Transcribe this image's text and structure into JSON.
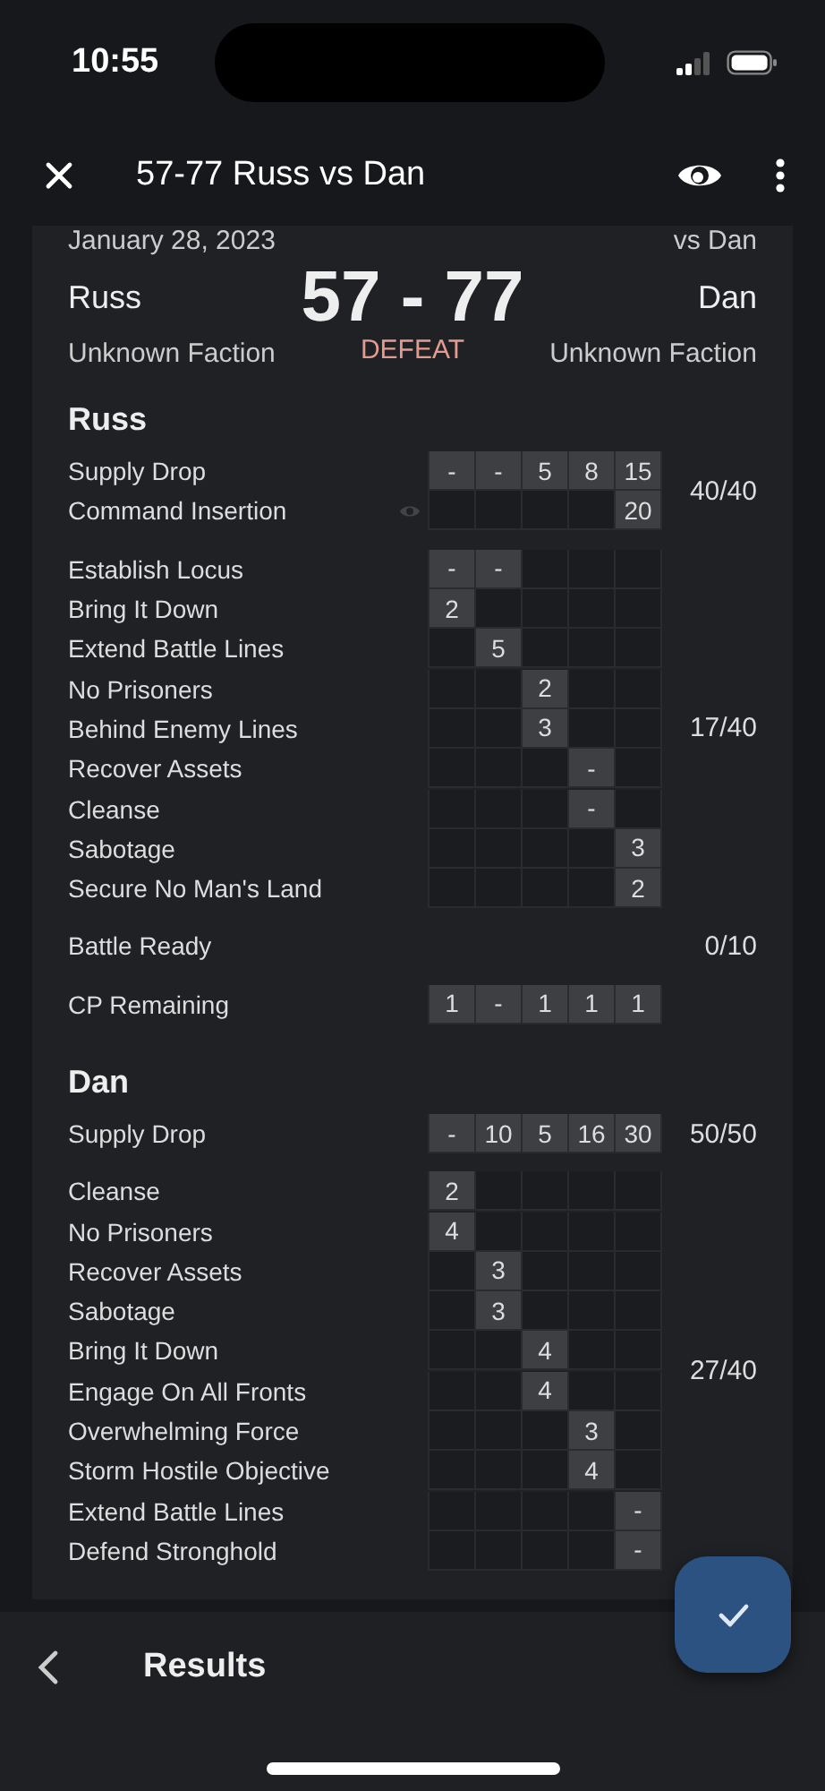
{
  "status_bar": {
    "time": "10:55"
  },
  "header": {
    "title": "57-77 Russ vs Dan"
  },
  "summary": {
    "date": "January 28, 2023",
    "opponent": "vs Dan",
    "left": {
      "name": "Russ",
      "faction": "Unknown Faction"
    },
    "right": {
      "name": "Dan",
      "faction": "Unknown Faction"
    },
    "score": "57 - 77",
    "result": "DEFEAT"
  },
  "players": [
    {
      "name": "Russ",
      "groups": [
        {
          "kind": "grid",
          "total": "40/40",
          "rows": [
            {
              "label": "Supply Drop",
              "secret": false,
              "cells": [
                "-",
                "-",
                "5",
                "8",
                "15"
              ]
            },
            {
              "label": "Command Insertion",
              "secret": true,
              "cells": [
                null,
                null,
                null,
                null,
                "20"
              ]
            }
          ]
        },
        {
          "kind": "grid",
          "total": "17/40",
          "rows": [
            {
              "label": "Establish Locus",
              "secret": false,
              "cells": [
                "-",
                "-",
                null,
                null,
                null
              ]
            },
            {
              "label": "Bring It Down",
              "secret": false,
              "cells": [
                "2",
                null,
                null,
                null,
                null
              ]
            },
            {
              "label": "Extend Battle Lines",
              "secret": false,
              "cells": [
                null,
                "5",
                null,
                null,
                null
              ]
            },
            {
              "label": "No Prisoners",
              "secret": false,
              "cells": [
                null,
                null,
                "2",
                null,
                null
              ]
            },
            {
              "label": "Behind Enemy Lines",
              "secret": false,
              "cells": [
                null,
                null,
                "3",
                null,
                null
              ]
            },
            {
              "label": "Recover Assets",
              "secret": false,
              "cells": [
                null,
                null,
                null,
                "-",
                null
              ]
            },
            {
              "label": "Cleanse",
              "secret": false,
              "cells": [
                null,
                null,
                null,
                "-",
                null
              ]
            },
            {
              "label": "Sabotage",
              "secret": false,
              "cells": [
                null,
                null,
                null,
                null,
                "3"
              ]
            },
            {
              "label": "Secure No Man's Land",
              "secret": false,
              "cells": [
                null,
                null,
                null,
                null,
                "2"
              ]
            }
          ]
        },
        {
          "kind": "plain",
          "total": "0/10",
          "rows": [
            {
              "label": "Battle Ready"
            }
          ]
        },
        {
          "kind": "grid",
          "rows": [
            {
              "label": "CP Remaining",
              "secret": false,
              "cells": [
                "1",
                "-",
                "1",
                "1",
                "1"
              ]
            }
          ]
        }
      ]
    },
    {
      "name": "Dan",
      "groups": [
        {
          "kind": "grid",
          "total": "50/50",
          "rows": [
            {
              "label": "Supply Drop",
              "secret": false,
              "cells": [
                "-",
                "10",
                "5",
                "16",
                "30"
              ]
            }
          ]
        },
        {
          "kind": "grid",
          "total": "27/40",
          "rows": [
            {
              "label": "Cleanse",
              "secret": false,
              "cells": [
                "2",
                null,
                null,
                null,
                null
              ]
            },
            {
              "label": "No Prisoners",
              "secret": false,
              "cells": [
                "4",
                null,
                null,
                null,
                null
              ]
            },
            {
              "label": "Recover Assets",
              "secret": false,
              "cells": [
                null,
                "3",
                null,
                null,
                null
              ]
            },
            {
              "label": "Sabotage",
              "secret": false,
              "cells": [
                null,
                "3",
                null,
                null,
                null
              ]
            },
            {
              "label": "Bring It Down",
              "secret": false,
              "cells": [
                null,
                null,
                "4",
                null,
                null
              ]
            },
            {
              "label": "Engage On All Fronts",
              "secret": false,
              "cells": [
                null,
                null,
                "4",
                null,
                null
              ]
            },
            {
              "label": "Overwhelming Force",
              "secret": false,
              "cells": [
                null,
                null,
                null,
                "3",
                null
              ]
            },
            {
              "label": "Storm Hostile Objective",
              "secret": false,
              "cells": [
                null,
                null,
                null,
                "4",
                null
              ]
            },
            {
              "label": "Extend Battle Lines",
              "secret": false,
              "cells": [
                null,
                null,
                null,
                null,
                "-"
              ]
            },
            {
              "label": "Defend Stronghold",
              "secret": false,
              "cells": [
                null,
                null,
                null,
                null,
                "-"
              ]
            }
          ]
        }
      ]
    }
  ],
  "bottom_bar": {
    "title": "Results"
  }
}
